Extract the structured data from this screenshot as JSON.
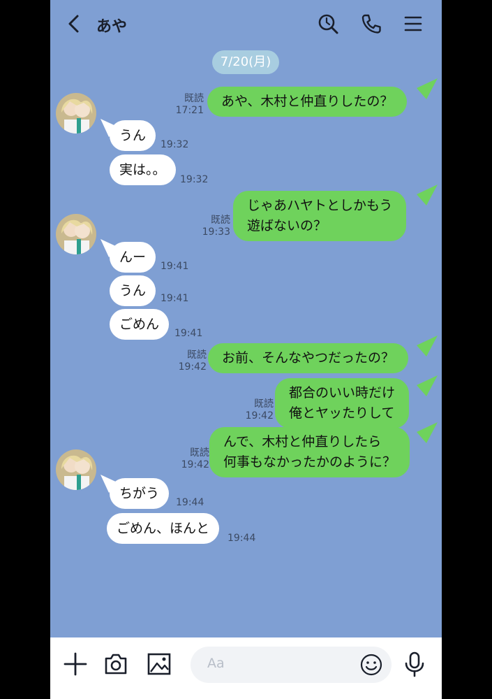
{
  "header": {
    "title": "あや",
    "icons": [
      "back-icon",
      "search-icon",
      "phone-icon",
      "menu-icon"
    ]
  },
  "date_label": "7/20(月)",
  "read_label": "既読",
  "messages": [
    {
      "side": "out",
      "lines": [
        "あや、木村と仲直りしたの？"
      ],
      "read": "既読",
      "time": "17:21"
    },
    {
      "side": "in",
      "text": "うん",
      "time": "19:32"
    },
    {
      "side": "in",
      "text": "実は。。",
      "time": "19:32"
    },
    {
      "side": "out",
      "lines": [
        "じゃあハヤトとしかもう",
        "遊ばないの？"
      ],
      "read": "既読",
      "time": "19:33"
    },
    {
      "side": "in",
      "text": "んー",
      "time": "19:41"
    },
    {
      "side": "in",
      "text": "うん",
      "time": "19:41"
    },
    {
      "side": "in",
      "text": "ごめん",
      "time": "19:41"
    },
    {
      "side": "out",
      "lines": [
        "お前、そんなやつだったの？"
      ],
      "read": "既読",
      "time": "19:42"
    },
    {
      "side": "out",
      "lines": [
        "都合のいい時だけ",
        "俺とヤッたりして"
      ],
      "read": "既読",
      "time": "19:42"
    },
    {
      "side": "out",
      "lines": [
        "んで、木村と仲直りしたら",
        "何事もなかったかのように？"
      ],
      "read": "既読",
      "time": "19:42"
    },
    {
      "side": "in",
      "text": "ちがう",
      "time": "19:44"
    },
    {
      "side": "in",
      "text": "ごめん、ほんと",
      "time": "19:44"
    }
  ],
  "footer": {
    "placeholder": "Aa",
    "icons": [
      "plus-icon",
      "camera-icon",
      "image-icon",
      "emoji-icon",
      "microphone-icon"
    ]
  },
  "colors": {
    "background": "#7f9fd3",
    "sent_bubble": "#6fd25c",
    "received_bubble": "#ffffff",
    "date_pill": "#a8cde0"
  }
}
